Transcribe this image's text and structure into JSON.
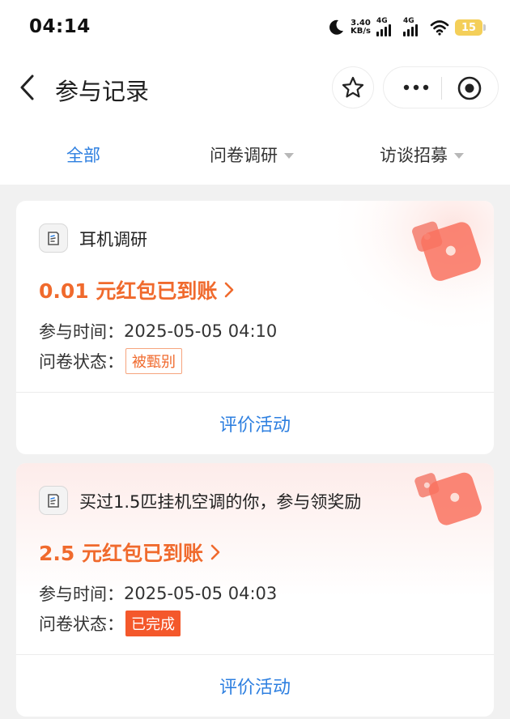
{
  "status_bar": {
    "time": "04:14",
    "speed_value": "3.40",
    "speed_unit": "KB/s",
    "sim1": "4G",
    "sim2": "4G",
    "battery": "15"
  },
  "header": {
    "title": "参与记录"
  },
  "tabs": [
    {
      "label": "全部",
      "active": true
    },
    {
      "label": "问卷调研",
      "dropdown": true
    },
    {
      "label": "访谈招募",
      "dropdown": true
    }
  ],
  "labels": {
    "time_label": "参与时间：",
    "status_label": "问卷状态："
  },
  "cards": [
    {
      "title": "耳机调研",
      "reward": "0.01 元红包已到账",
      "time": "2025-05-05 04:10",
      "status": "被甄别",
      "action": "评价活动"
    },
    {
      "title": "买过1.5匹挂机空调的你，参与领奖励",
      "reward": "2.5 元红包已到账",
      "time": "2025-05-05 04:03",
      "status": "已完成",
      "action": "评价活动"
    }
  ],
  "colors": {
    "accent_blue": "#2d7fe0",
    "reward_orange": "#f06a2d",
    "badge_red": "#f4582b"
  }
}
